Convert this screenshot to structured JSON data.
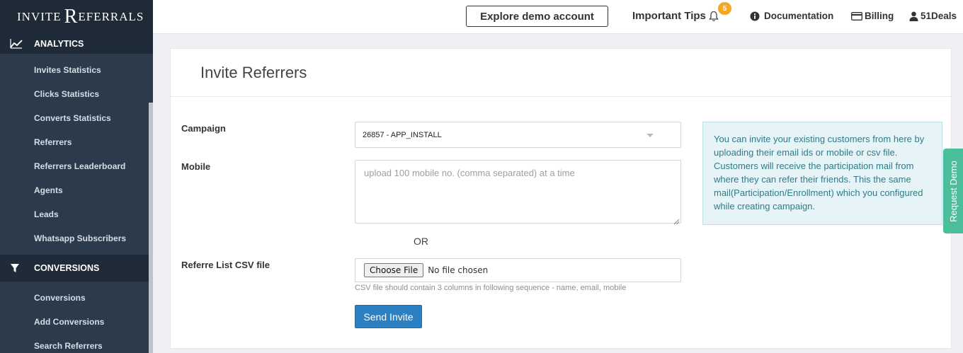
{
  "brand": {
    "logo_small_1": "INVITE",
    "logo_big": "R",
    "logo_rest": "EFERRALS"
  },
  "sidebar": {
    "analytics_header": "ANALYTICS",
    "analytics_items": [
      {
        "label": "Invites Statistics"
      },
      {
        "label": "Clicks Statistics"
      },
      {
        "label": "Converts Statistics"
      },
      {
        "label": "Referrers"
      },
      {
        "label": "Referrers Leaderboard"
      },
      {
        "label": "Agents"
      },
      {
        "label": "Leads"
      },
      {
        "label": "Whatsapp Subscribers"
      }
    ],
    "conversions_header": "CONVERSIONS",
    "conversions_items": [
      {
        "label": "Conversions"
      },
      {
        "label": "Add Conversions"
      },
      {
        "label": "Search Referrers"
      }
    ]
  },
  "topbar": {
    "explore_label": "Explore demo account",
    "tips_label": "Important Tips",
    "tips_count": "5",
    "documentation_label": "Documentation",
    "billing_label": "Billing",
    "user_label": "51Deals"
  },
  "page": {
    "title": "Invite Referrers",
    "campaign_label": "Campaign",
    "campaign_value": "26857 - APP_INSTALL",
    "mobile_label": "Mobile",
    "mobile_placeholder": "upload 100 mobile no. (comma separated) at a time",
    "or_text": "OR",
    "csv_label": "Referre List CSV file",
    "choose_file_label": "Choose File",
    "no_file_text": "No file chosen",
    "csv_help": "CSV file should contain 3 columns in following sequence - name, email, mobile",
    "send_label": "Send Invite",
    "info_text": "You can invite your existing customers from here by uploading their email ids or mobile or csv file. Customers will receive the participation mail from where they can refer their friends. This the same mail(Participation/Enrollment) which you configured while creating campaign."
  },
  "request_demo": "Request Demo",
  "colors": {
    "sidebar": "#2c3b4c",
    "accent": "#2c7fc0",
    "badge": "#f5a623",
    "info_bg": "#e6f4f7",
    "request_demo": "#4bbf9c"
  }
}
